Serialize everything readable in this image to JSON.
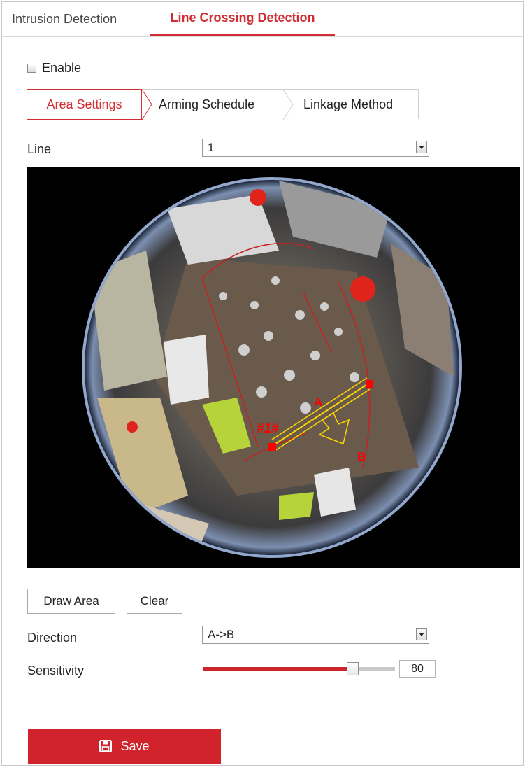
{
  "tabs": [
    {
      "label": "Intrusion Detection",
      "active": false
    },
    {
      "label": "Line Crossing Detection",
      "active": true
    }
  ],
  "enable": {
    "label": "Enable",
    "checked": false
  },
  "sub_tabs": [
    {
      "label": "Area Settings",
      "active": true
    },
    {
      "label": "Arming Schedule",
      "active": false
    },
    {
      "label": "Linkage Method",
      "active": false
    }
  ],
  "line": {
    "label": "Line",
    "value": "1"
  },
  "video": {
    "line_id_label": "#1#",
    "point_a_label": "A",
    "point_b_label": "B"
  },
  "buttons": {
    "draw_area": "Draw Area",
    "clear": "Clear"
  },
  "direction": {
    "label": "Direction",
    "value": "A->B"
  },
  "sensitivity": {
    "label": "Sensitivity",
    "value": "80",
    "level_percent": 80
  },
  "save": {
    "label": "Save"
  },
  "colors": {
    "accent": "#d22d32",
    "save_bg": "#d0232b",
    "overlay_line": "#ffd700",
    "marker": "#ff0000"
  },
  "icons": {
    "save": "floppy-disk-icon",
    "dropdown": "chevron-down-icon"
  }
}
